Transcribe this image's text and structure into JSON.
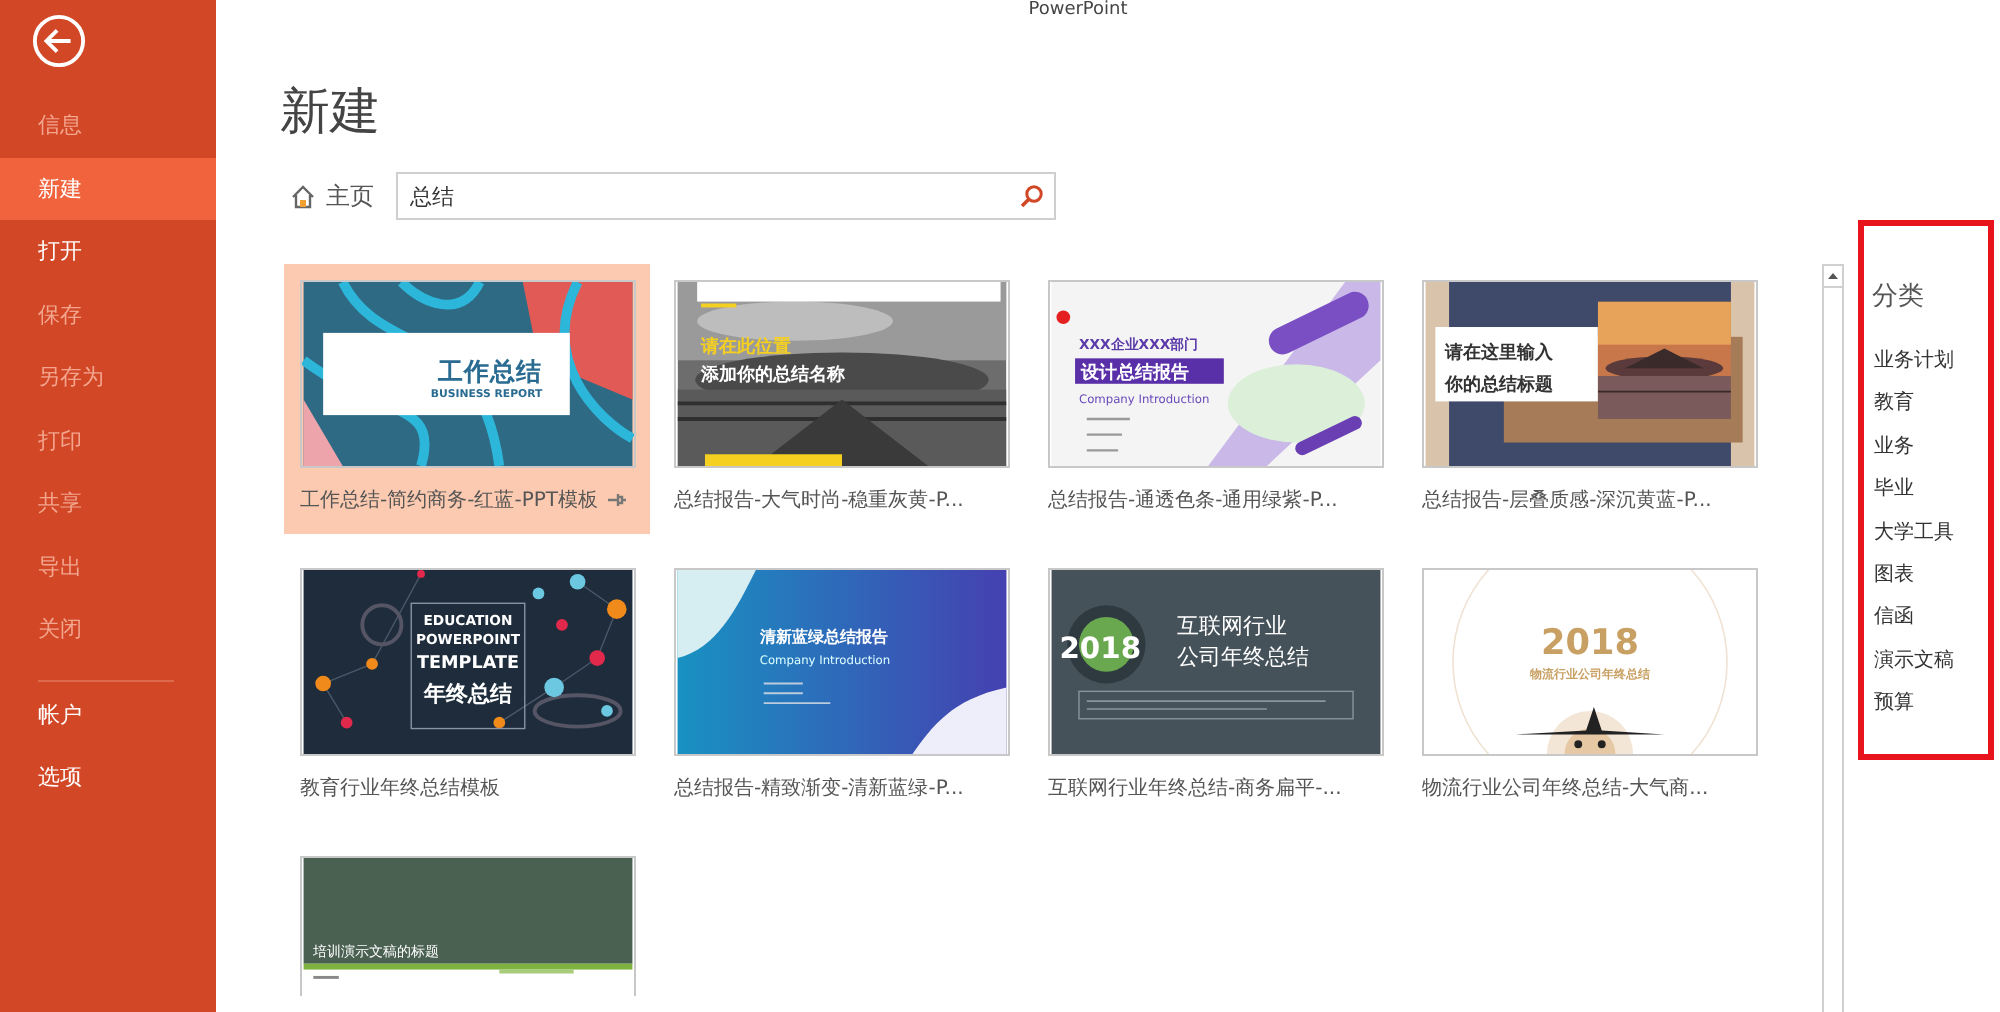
{
  "window": {
    "title": "PowerPoint"
  },
  "sidebar": {
    "items": [
      {
        "label": "信息",
        "disabled": true,
        "selected": false
      },
      {
        "label": "新建",
        "disabled": false,
        "selected": true
      },
      {
        "label": "打开",
        "disabled": false,
        "selected": false
      },
      {
        "label": "保存",
        "disabled": true,
        "selected": false
      },
      {
        "label": "另存为",
        "disabled": true,
        "selected": false
      },
      {
        "label": "打印",
        "disabled": true,
        "selected": false
      },
      {
        "label": "共享",
        "disabled": true,
        "selected": false
      },
      {
        "label": "导出",
        "disabled": true,
        "selected": false
      },
      {
        "label": "关闭",
        "disabled": true,
        "selected": false
      }
    ],
    "bottom_items": [
      {
        "label": "帐户",
        "disabled": false,
        "selected": false
      },
      {
        "label": "选项",
        "disabled": false,
        "selected": false
      }
    ]
  },
  "heading": "新建",
  "breadcrumb": {
    "label": "主页"
  },
  "search": {
    "value": "总结"
  },
  "templates": [
    {
      "title": "工作总结-简约商务-红蓝-PPT模板",
      "selected": true,
      "pinned": true,
      "thumbnail": {
        "kind": "waves",
        "texts": [
          "工作总结",
          "BUSINESS REPORT"
        ]
      }
    },
    {
      "title": "总结报告-大气时尚-稳重灰黄-P...",
      "selected": false,
      "pinned": false,
      "thumbnail": {
        "kind": "photo-dark",
        "texts": [
          "请在此位置",
          "添加你的总结名称"
        ]
      }
    },
    {
      "title": "总结报告-通透色条-通用绿紫-P...",
      "selected": false,
      "pinned": false,
      "thumbnail": {
        "kind": "stripes",
        "texts": [
          "XXX企业XXX部门",
          "设计总结报告",
          "Company Introduction"
        ]
      }
    },
    {
      "title": "总结报告-层叠质感-深沉黄蓝-P...",
      "selected": false,
      "pinned": false,
      "thumbnail": {
        "kind": "navy-photo",
        "texts": [
          "请在这里输入",
          "你的总结标题"
        ]
      }
    },
    {
      "title": "教育行业年终总结模板",
      "selected": false,
      "pinned": false,
      "thumbnail": {
        "kind": "education",
        "texts": [
          "EDUCATION",
          "POWERPOINT",
          "TEMPLATE",
          "年终总结"
        ]
      }
    },
    {
      "title": "总结报告-精致渐变-清新蓝绿-P...",
      "selected": false,
      "pinned": false,
      "thumbnail": {
        "kind": "gradient",
        "texts": [
          "清新蓝绿总结报告",
          "Company Introduction"
        ]
      }
    },
    {
      "title": "互联网行业年终总结-商务扁平-...",
      "selected": false,
      "pinned": false,
      "thumbnail": {
        "kind": "internet",
        "texts": [
          "2018",
          "互联网行业",
          "公司年终总结"
        ]
      }
    },
    {
      "title": "物流行业公司年终总结-大气商...",
      "selected": false,
      "pinned": false,
      "thumbnail": {
        "kind": "logistics",
        "texts": [
          "2018",
          "物流行业公司年终总结"
        ]
      }
    },
    {
      "selected": false,
      "thumbnail": {
        "kind": "board",
        "texts": [
          "培训演示文稿的标题"
        ]
      }
    }
  ],
  "categories": {
    "title": "分类",
    "items": [
      "业务计划",
      "教育",
      "业务",
      "毕业",
      "大学工具",
      "图表",
      "信函",
      "演示文稿",
      "预算"
    ]
  }
}
